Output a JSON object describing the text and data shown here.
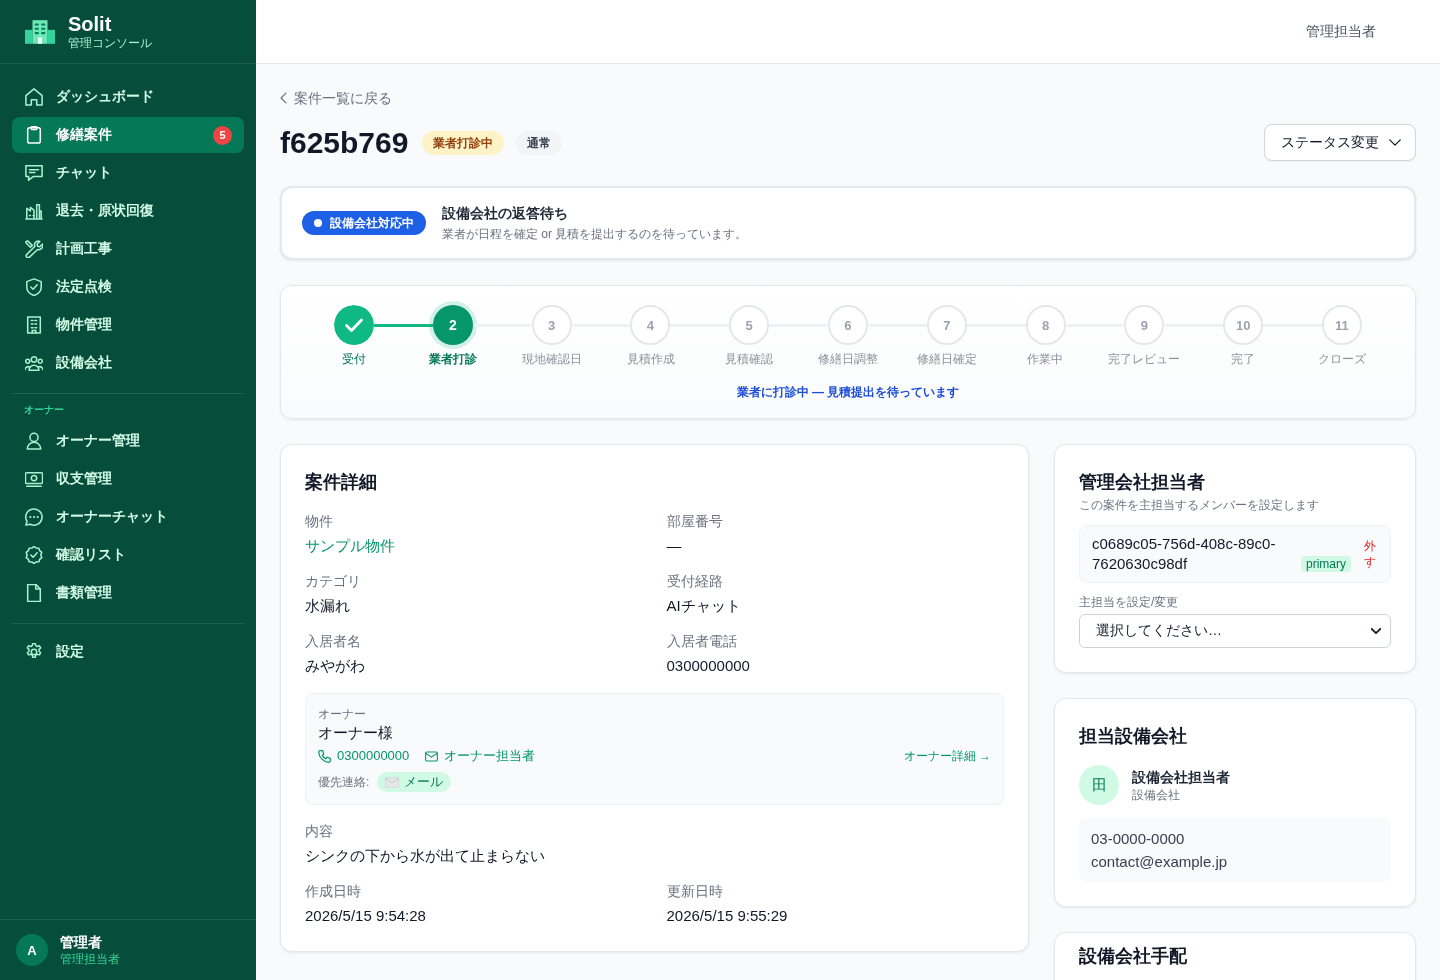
{
  "sidebar": {
    "brand": {
      "name": "Solit",
      "subtitle": "管理コンソール"
    },
    "sections": [
      {
        "items": [
          {
            "label": "ダッシュボード",
            "selected": false
          },
          {
            "label": "修繕案件",
            "selected": true,
            "badge": "5"
          },
          {
            "label": "チャット",
            "selected": false
          },
          {
            "label": "退去・原状回復",
            "selected": false
          },
          {
            "label": "計画工事",
            "selected": false
          },
          {
            "label": "法定点検",
            "selected": false
          },
          {
            "label": "物件管理",
            "selected": false
          },
          {
            "label": "設備会社",
            "selected": false
          }
        ]
      },
      {
        "label": "オーナー",
        "items": [
          {
            "label": "オーナー管理",
            "selected": false
          },
          {
            "label": "収支管理",
            "selected": false
          },
          {
            "label": "オーナーチャット",
            "selected": false
          },
          {
            "label": "確認リスト",
            "selected": false
          },
          {
            "label": "書類管理",
            "selected": false
          }
        ]
      },
      {
        "items": [
          {
            "label": "設定",
            "selected": false
          }
        ]
      }
    ],
    "user": {
      "avatar": "A",
      "name": "管理者",
      "role": "管理担当者"
    }
  },
  "header": {
    "user": "管理担当者"
  },
  "page": {
    "back_link": "案件一覧に戻る",
    "title": "f625b769",
    "badges": [
      {
        "label": "業者打診中",
        "kind": "status"
      },
      {
        "label": "通常",
        "kind": "priority"
      }
    ],
    "status_button": "ステータス変更"
  },
  "alert": {
    "pill": "設備会社対応中",
    "title": "設備会社の返答待ち",
    "text": "業者が日程を確定 or 見積を提出するのを待っています。"
  },
  "stepper": {
    "steps": [
      {
        "label": "受付",
        "done": true,
        "current": false
      },
      {
        "number": "2",
        "label": "業者打診",
        "done": false,
        "current": true
      },
      {
        "number": "3",
        "label": "現地確認日",
        "done": false,
        "current": false
      },
      {
        "number": "4",
        "label": "見積作成",
        "done": false,
        "current": false
      },
      {
        "number": "5",
        "label": "見積確認",
        "done": false,
        "current": false
      },
      {
        "number": "6",
        "label": "修繕日調整",
        "done": false,
        "current": false
      },
      {
        "number": "7",
        "label": "修繕日確定",
        "done": false,
        "current": false
      },
      {
        "number": "8",
        "label": "作業中",
        "done": false,
        "current": false
      },
      {
        "number": "9",
        "label": "完了レビュー",
        "done": false,
        "current": false
      },
      {
        "number": "10",
        "label": "完了",
        "done": false,
        "current": false
      },
      {
        "number": "11",
        "label": "クローズ",
        "done": false,
        "current": false
      }
    ],
    "caption": "業者に打診中 — 見積提出を待っています"
  },
  "details": {
    "title": "案件詳細",
    "fields": [
      {
        "label": "物件",
        "value": "サンプル物件",
        "kind": "link"
      },
      {
        "label": "部屋番号",
        "value": "—",
        "kind": "text"
      },
      {
        "label": "カテゴリ",
        "value": "水漏れ",
        "kind": "text"
      },
      {
        "label": "受付経路",
        "value": "AIチャット",
        "kind": "text"
      },
      {
        "label": "入居者名",
        "value": "みやがわ",
        "kind": "text"
      },
      {
        "label": "入居者電話",
        "value": "0300000000",
        "kind": "text"
      }
    ],
    "owner": {
      "label": "オーナー",
      "name": "オーナー様",
      "phone": "0300000000",
      "contact": "オーナー担当者",
      "detail_link": "オーナー詳細 →",
      "preferred_label": "優先連絡:",
      "preferred": "メール"
    },
    "description": {
      "label": "内容",
      "value": "シンクの下から水が出て止まらない"
    },
    "timestamps": [
      {
        "label": "作成日時",
        "value": "2026/5/15 9:54:28"
      },
      {
        "label": "更新日時",
        "value": "2026/5/15 9:55:29"
      }
    ]
  },
  "manager": {
    "title": "管理会社担当者",
    "subtitle": "この案件を主担当するメンバーを設定します",
    "members": [
      {
        "id": "c0689c05-756d-408c-89c0-7620630c98df",
        "badge": "primary",
        "remove": "外す"
      }
    ],
    "select_label": "主担当を設定/変更",
    "select_placeholder": "選択してください…"
  },
  "vendor": {
    "title": "担当設備会社",
    "avatar": "田",
    "name": "設備会社担当者",
    "company": "設備会社",
    "phone": "03-0000-0000",
    "email": "contact@example.jp"
  },
  "arrangement": {
    "title": "設備会社手配"
  }
}
